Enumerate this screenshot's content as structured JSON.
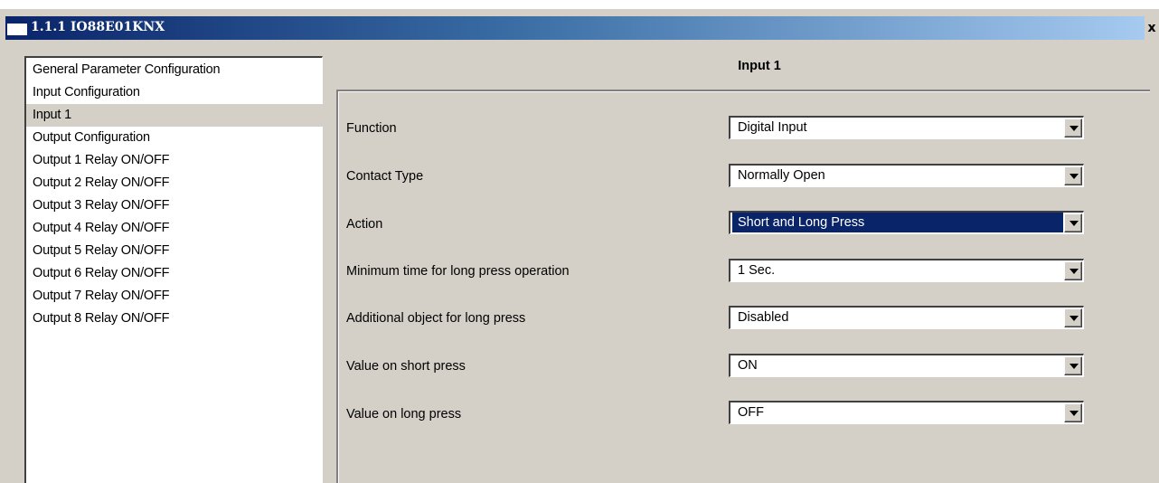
{
  "window": {
    "title": "1.1.1 IO88E01KNX",
    "close_label": "x"
  },
  "sidebar": {
    "selected_index": 2,
    "items": [
      {
        "label": "General Parameter Configuration"
      },
      {
        "label": "Input Configuration"
      },
      {
        "label": "Input 1"
      },
      {
        "label": "Output Configuration"
      },
      {
        "label": "Output 1 Relay ON/OFF"
      },
      {
        "label": "Output 2 Relay ON/OFF"
      },
      {
        "label": "Output 3 Relay ON/OFF"
      },
      {
        "label": "Output 4 Relay ON/OFF"
      },
      {
        "label": "Output 5 Relay ON/OFF"
      },
      {
        "label": "Output 6 Relay ON/OFF"
      },
      {
        "label": "Output 7 Relay ON/OFF"
      },
      {
        "label": "Output 8 Relay ON/OFF"
      }
    ]
  },
  "panel": {
    "title": "Input 1",
    "params": [
      {
        "label": "Function",
        "value": "Digital Input"
      },
      {
        "label": "Contact Type",
        "value": "Normally Open"
      },
      {
        "label": "Action",
        "value": "Short and  Long Press",
        "highlighted": true
      },
      {
        "label": "Minimum time for long press operation",
        "value": "1 Sec."
      },
      {
        "label": "Additional object for long press",
        "value": "Disabled"
      },
      {
        "label": "Value on short press",
        "value": "ON"
      },
      {
        "label": "Value on long press",
        "value": "OFF"
      }
    ]
  },
  "colors": {
    "face": "#d4d0c8",
    "selection": "#0a246a",
    "title_gradient_start": "#0a246a",
    "title_gradient_end": "#a6caf0"
  }
}
